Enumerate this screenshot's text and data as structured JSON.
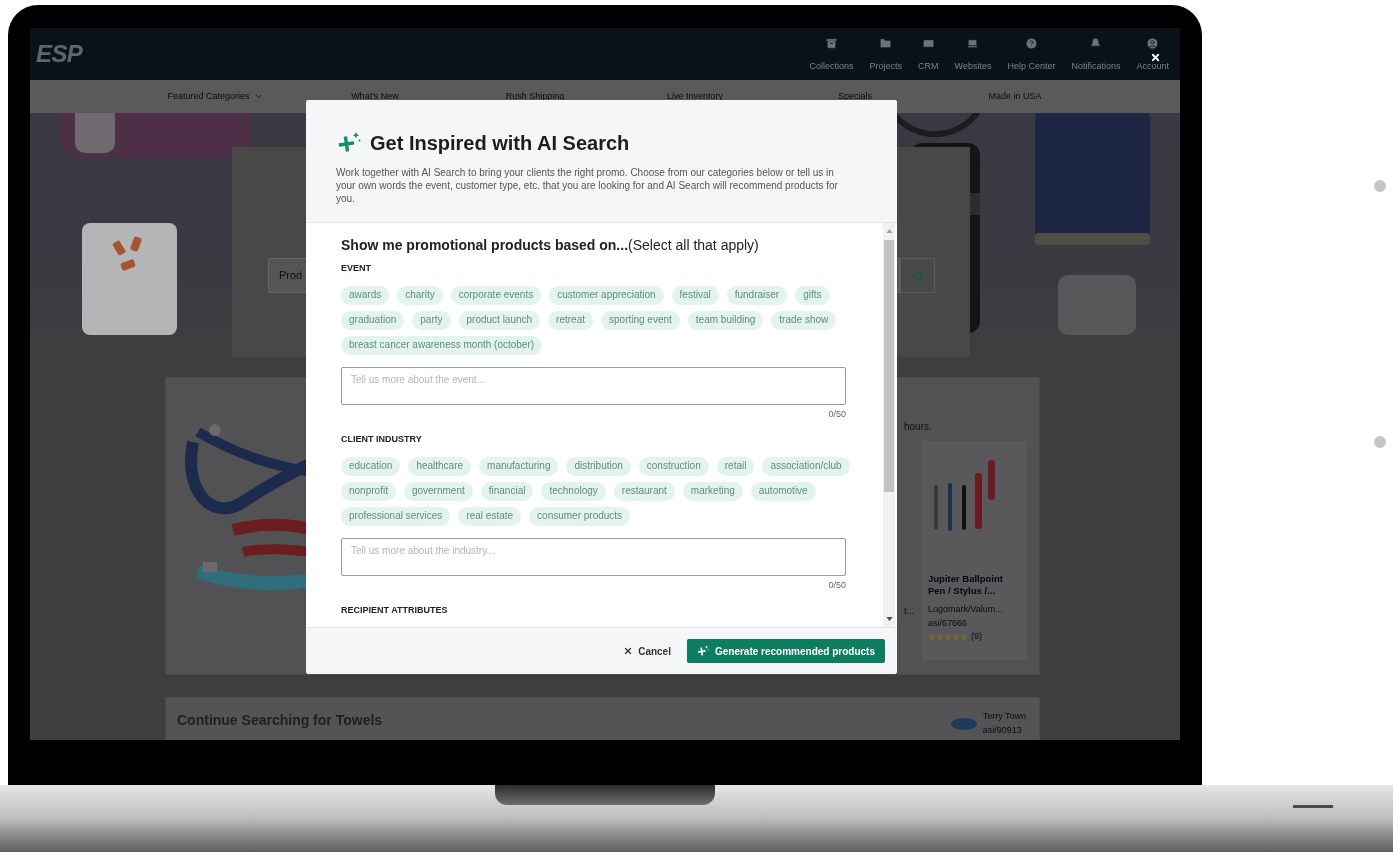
{
  "nav": {
    "logo": "ESP",
    "items": [
      {
        "label": "Collections"
      },
      {
        "label": "Projects"
      },
      {
        "label": "CRM"
      },
      {
        "label": "Websites"
      },
      {
        "label": "Help Center"
      },
      {
        "label": "Notifications"
      },
      {
        "label": "Account"
      }
    ]
  },
  "subnav": [
    {
      "label": "Featured Categories",
      "dropdown": true
    },
    {
      "label": "What's New",
      "dropdown": false
    },
    {
      "label": "Rush Shipping",
      "dropdown": false
    },
    {
      "label": "Live Inventory",
      "dropdown": false
    },
    {
      "label": "Specials",
      "dropdown": false
    },
    {
      "label": "Made in USA",
      "dropdown": false
    }
  ],
  "search": {
    "placeholder": "Prod"
  },
  "featured": {
    "note": "hours.",
    "partial_text": "t...",
    "product": {
      "name": "Jupiter Ballpoint Pen / Stylus /...",
      "supplier": "Logomark/Valum...",
      "asi": "asi/67666",
      "stars": 5,
      "reviews": "(9)"
    }
  },
  "continue": {
    "title": "Continue Searching for Towels",
    "supplier": {
      "name": "Terry Town",
      "asi": "asi/90913"
    }
  },
  "modal": {
    "title": "Get Inspired with AI Search",
    "description": "Work together with AI Search to bring your clients the right promo. Choose from our categories below or tell us in your own words the event, customer type, etc. that you are looking for and AI Search will recommend products for you.",
    "prompt": "**Show me promotional products based on...**(Select all that apply)",
    "sections": [
      {
        "label": "EVENT",
        "tags": [
          {
            "label": "awards",
            "selected": false
          },
          {
            "label": "charity",
            "selected": false
          },
          {
            "label": "corporate events",
            "selected": false
          },
          {
            "label": "customer appreciation",
            "selected": false
          },
          {
            "label": "festival",
            "selected": false
          },
          {
            "label": "fundraiser",
            "selected": false
          },
          {
            "label": "gifts",
            "selected": false
          },
          {
            "label": "graduation",
            "selected": false
          },
          {
            "label": "party",
            "selected": false
          },
          {
            "label": "product launch",
            "selected": false
          },
          {
            "label": "retreat",
            "selected": false
          },
          {
            "label": "sporting event",
            "selected": false
          },
          {
            "label": "team building",
            "selected": false
          },
          {
            "label": "trade show",
            "selected": false
          },
          {
            "label": "breast cancer awareness month (october)",
            "selected": false
          }
        ],
        "field": {
          "placeholder": "Tell us more about the event...",
          "counter": "0/50"
        }
      },
      {
        "label": "CLIENT INDUSTRY",
        "tags": [
          {
            "label": "education",
            "selected": false
          },
          {
            "label": "healthcare",
            "selected": false
          },
          {
            "label": "manufacturing",
            "selected": false
          },
          {
            "label": "distribution",
            "selected": false
          },
          {
            "label": "construction",
            "selected": false
          },
          {
            "label": "retail",
            "selected": false
          },
          {
            "label": "association/club",
            "selected": false
          },
          {
            "label": "nonprofit",
            "selected": false
          },
          {
            "label": "government",
            "selected": false
          },
          {
            "label": "financial",
            "selected": false
          },
          {
            "label": "technology",
            "selected": false
          },
          {
            "label": "restaurant",
            "selected": false
          },
          {
            "label": "marketing",
            "selected": false
          },
          {
            "label": "automotive",
            "selected": false
          },
          {
            "label": "professional services",
            "selected": false
          },
          {
            "label": "real estate",
            "selected": false
          },
          {
            "label": "consumer products",
            "selected": false
          }
        ],
        "field": {
          "placeholder": "Tell us more about the industry...",
          "counter": "0/50"
        }
      },
      {
        "label": "RECIPIENT ATTRIBUTES"
      }
    ],
    "cancel": "Cancel",
    "submit": "Generate recommended products"
  }
}
